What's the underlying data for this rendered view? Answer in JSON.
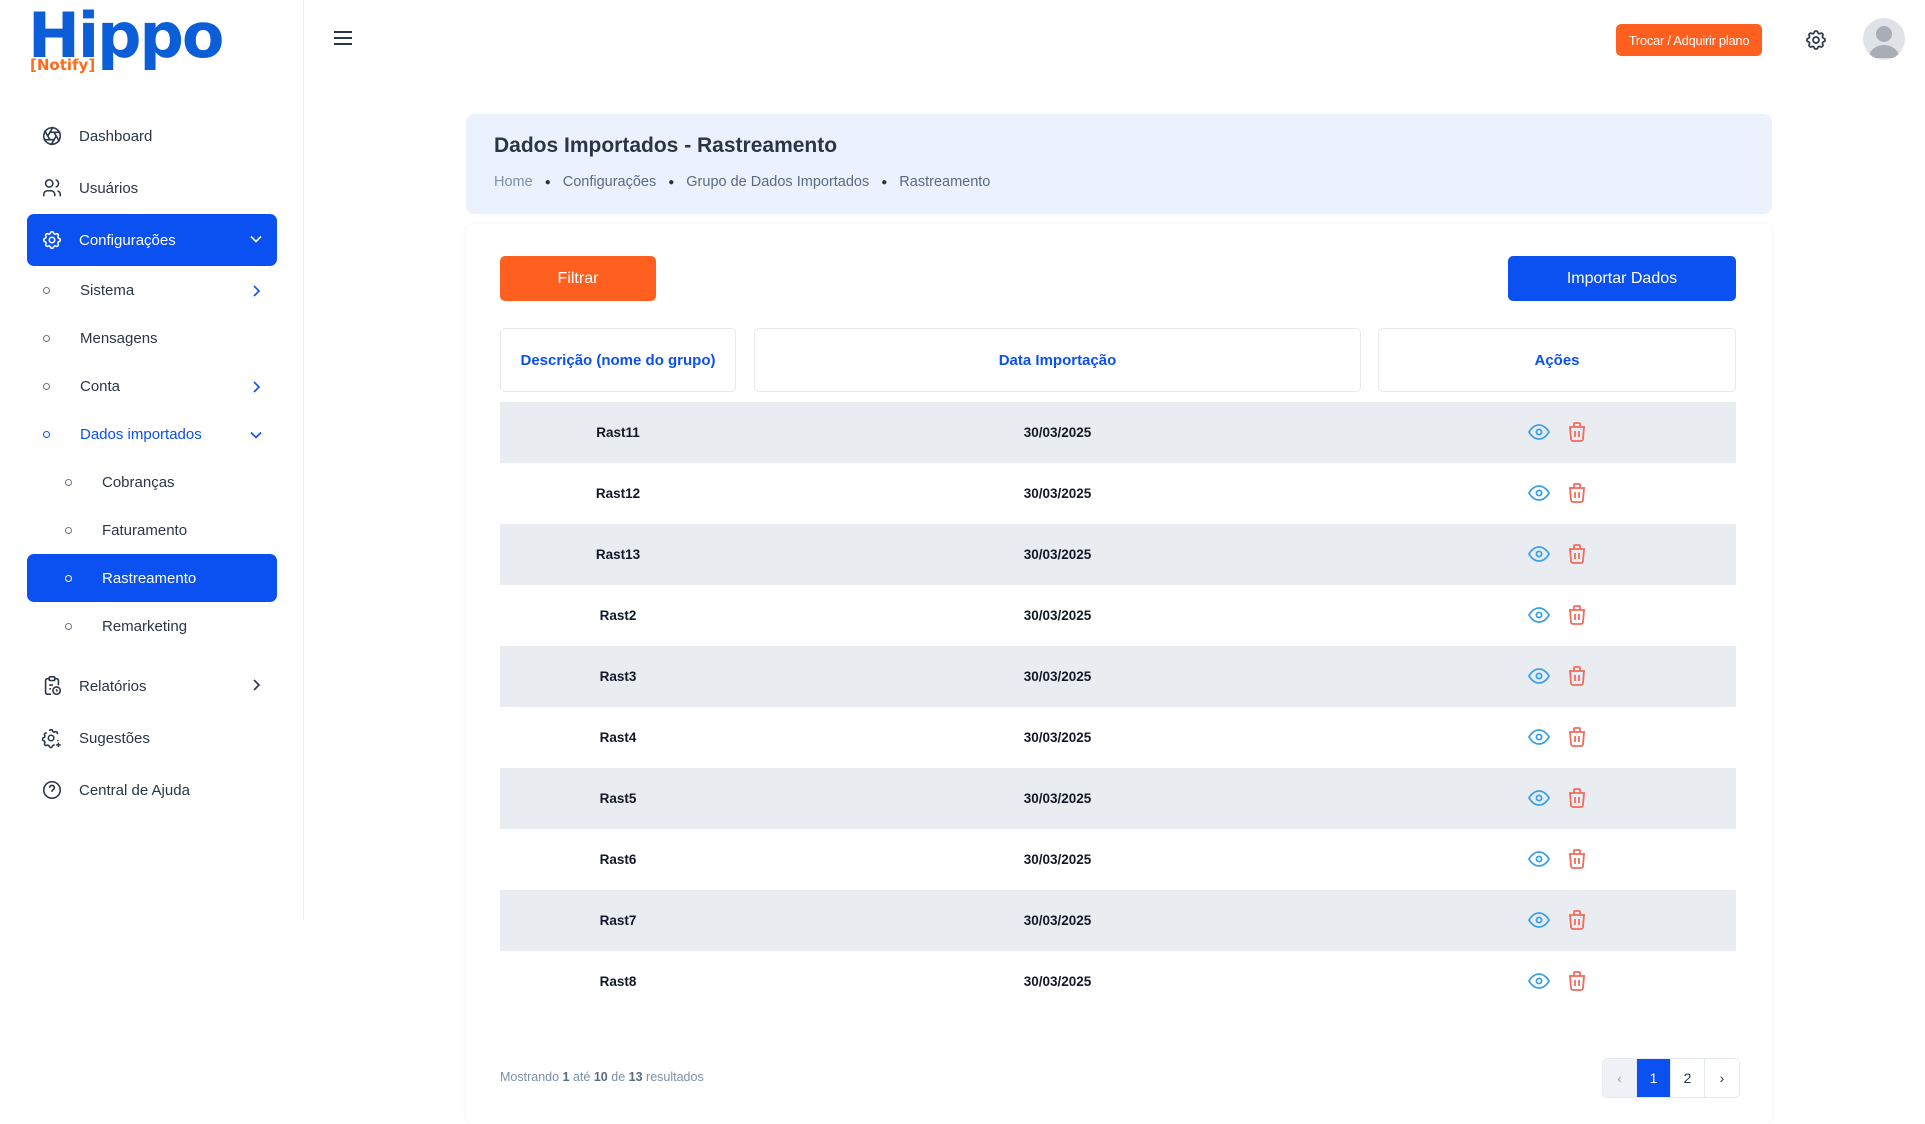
{
  "brand": {
    "logo_main": "Hippo",
    "logo_sub": "[Notify]"
  },
  "topbar": {
    "plan_button": "Trocar / Adquirir plano"
  },
  "sidebar": {
    "items": [
      {
        "label": "Dashboard",
        "icon": "aperture-icon"
      },
      {
        "label": "Usuários",
        "icon": "users-icon"
      },
      {
        "label": "Configurações",
        "icon": "gear-icon"
      },
      {
        "label": "Relatórios",
        "icon": "report-icon"
      },
      {
        "label": "Sugestões",
        "icon": "gear-plus-icon"
      },
      {
        "label": "Central de Ajuda",
        "icon": "help-icon"
      }
    ],
    "config_sub": [
      "Sistema",
      "Mensagens",
      "Conta",
      "Dados importados"
    ],
    "dados_sub": [
      "Cobranças",
      "Faturamento",
      "Rastreamento",
      "Remarketing"
    ]
  },
  "header": {
    "title": "Dados Importados - Rastreamento",
    "breadcrumb": [
      "Home",
      "Configurações",
      "Grupo de Dados Importados",
      "Rastreamento"
    ]
  },
  "toolbar": {
    "filter_label": "Filtrar",
    "import_label": "Importar Dados"
  },
  "table": {
    "columns": [
      "Descrição (nome do grupo)",
      "Data Importação",
      "Ações"
    ],
    "rows": [
      {
        "name": "Rast11",
        "date": "30/03/2025"
      },
      {
        "name": "Rast12",
        "date": "30/03/2025"
      },
      {
        "name": "Rast13",
        "date": "30/03/2025"
      },
      {
        "name": "Rast2",
        "date": "30/03/2025"
      },
      {
        "name": "Rast3",
        "date": "30/03/2025"
      },
      {
        "name": "Rast4",
        "date": "30/03/2025"
      },
      {
        "name": "Rast5",
        "date": "30/03/2025"
      },
      {
        "name": "Rast6",
        "date": "30/03/2025"
      },
      {
        "name": "Rast7",
        "date": "30/03/2025"
      },
      {
        "name": "Rast8",
        "date": "30/03/2025"
      }
    ]
  },
  "footer": {
    "showing_prefix": "Mostrando",
    "from": "1",
    "to_word": "até",
    "to": "10",
    "of_word": "de",
    "total": "13",
    "suffix": "resultados"
  },
  "pagination": {
    "prev": "‹",
    "pages": [
      "1",
      "2"
    ],
    "next": "›",
    "current": "1"
  },
  "colors": {
    "primary": "#0b50f0",
    "accent": "#ff5f1f",
    "eye": "#3aa0e8",
    "trash": "#f26b5b"
  }
}
